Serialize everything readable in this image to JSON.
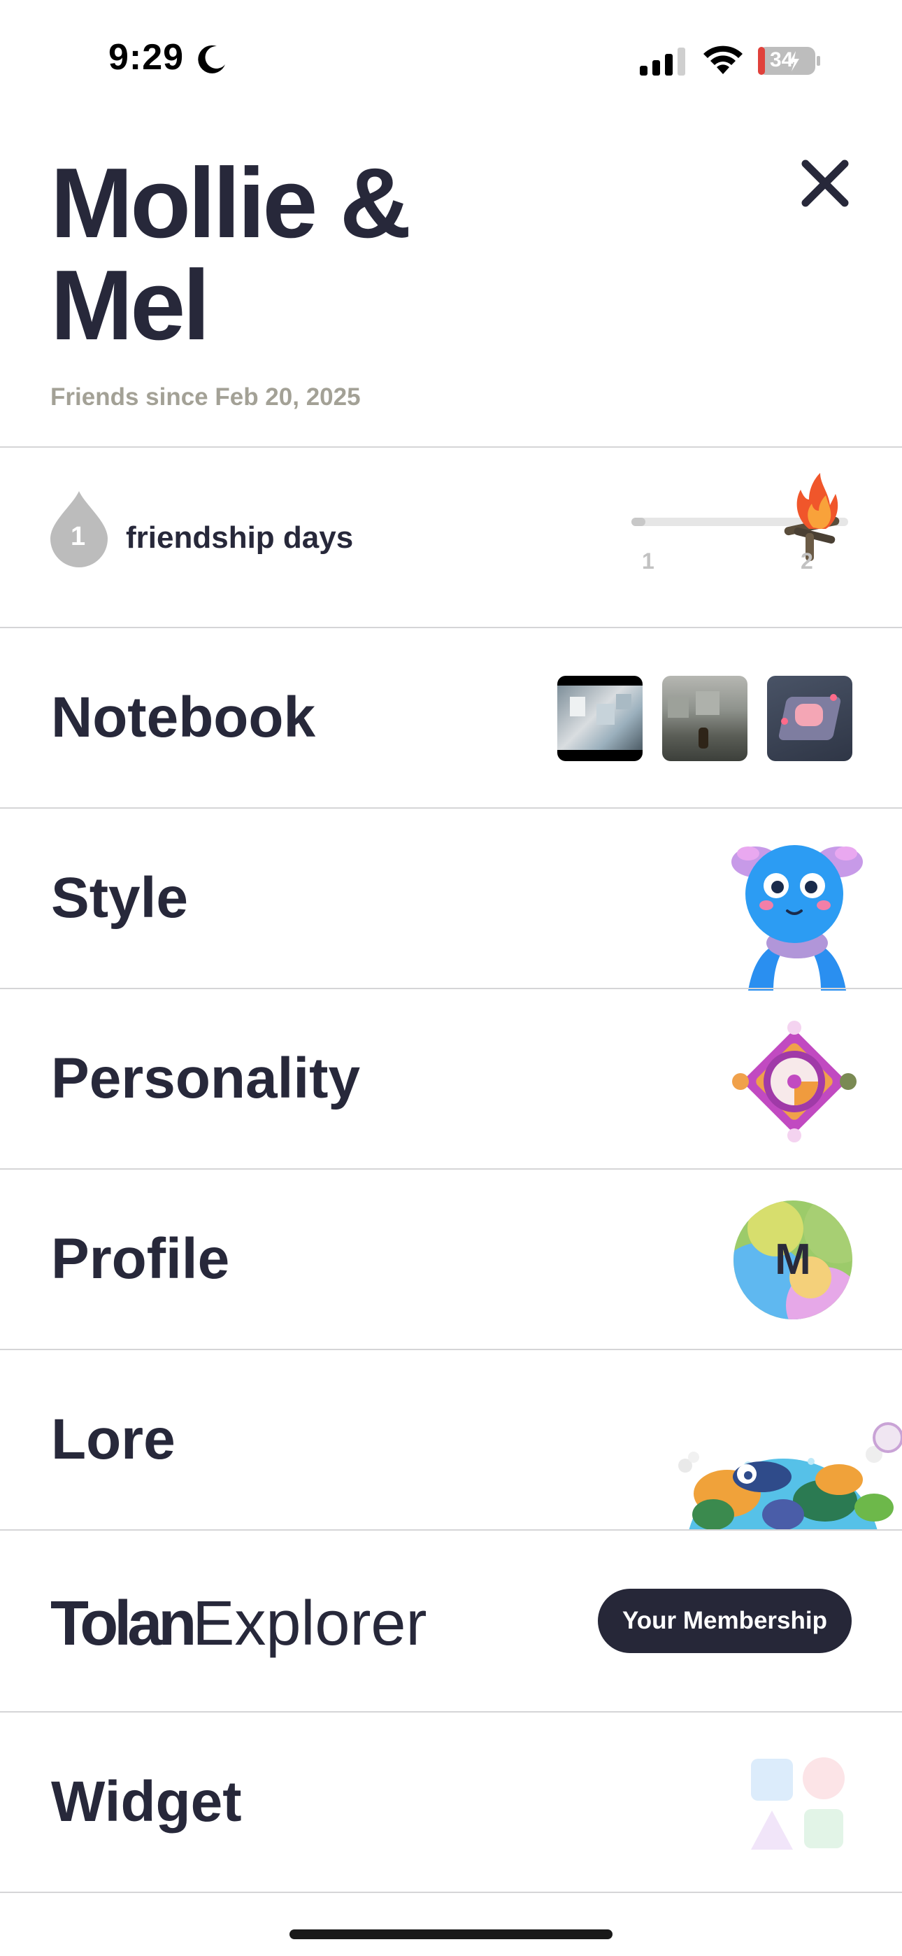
{
  "status_bar": {
    "time": "9:29",
    "battery": "34"
  },
  "header": {
    "title": "Mollie & Mel",
    "subtitle": "Friends since Feb 20, 2025"
  },
  "friendship": {
    "count": "1",
    "label": "friendship days",
    "progress_ticks": [
      "1",
      "2"
    ],
    "progress_fraction": 0.0
  },
  "menu": {
    "notebook": "Notebook",
    "style": "Style",
    "personality": "Personality",
    "profile": "Profile",
    "profile_avatar_letter": "M",
    "lore": "Lore",
    "brand_bold": "Tolan",
    "brand_regular": "Explorer",
    "membership_button": "Your Membership",
    "widget": "Widget"
  },
  "colors": {
    "text_dark": "#27283a",
    "subtitle": "#a3a196",
    "button_bg": "#262738",
    "divider": "#d5d5d7"
  }
}
